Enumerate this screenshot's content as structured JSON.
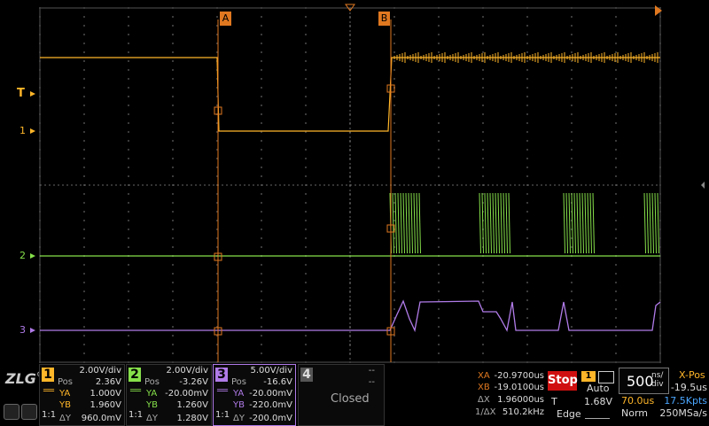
{
  "cursors": {
    "a_label": "A",
    "b_label": "B"
  },
  "left_markers": {
    "trigger": "T",
    "ch1": "1",
    "ch2": "2",
    "ch3": "3"
  },
  "channels": [
    {
      "num": "1",
      "color": "#ffb629",
      "scale": "2.00V/div",
      "pos_label": "Pos",
      "pos": "2.36V",
      "ya_label": "YA",
      "ya": "1.000V",
      "yb_label": "YB",
      "yb": "1.960V",
      "dy_label": "ΔY",
      "dy": "960.0mV",
      "coupling": "1:1"
    },
    {
      "num": "2",
      "color": "#86e04a",
      "scale": "2.00V/div",
      "pos_label": "Pos",
      "pos": "-3.26V",
      "ya_label": "YA",
      "ya": "-20.00mV",
      "yb_label": "YB",
      "yb": "1.260V",
      "dy_label": "ΔY",
      "dy": "1.280V",
      "coupling": "1:1"
    },
    {
      "num": "3",
      "color": "#b07be8",
      "scale": "5.00V/div",
      "pos_label": "Pos",
      "pos": "-16.6V",
      "ya_label": "YA",
      "ya": "-20.00mV",
      "yb_label": "YB",
      "yb": "-220.0mV",
      "dy_label": "ΔY",
      "dy": "-200.0mV",
      "coupling": "1:1"
    },
    {
      "num": "4",
      "color": "#555555",
      "scale": "--",
      "pos_label": "",
      "pos": "--",
      "status": "Closed"
    }
  ],
  "measurements": {
    "xa_label": "XA",
    "xa": "-20.9700us",
    "xb_label": "XB",
    "xb": "-19.0100us",
    "dx_label": "ΔX",
    "dx": "1.96000us",
    "inv_label": "1/ΔX",
    "inv": "510.2kHz"
  },
  "run_state": "Stop",
  "trigger": {
    "source": "1",
    "mode": "Auto",
    "level_label": "T",
    "level": "1.68V",
    "type": "Edge"
  },
  "timebase": {
    "value": "500",
    "unit_top": "ns/",
    "unit_bottom": "div",
    "xpos_label": "X-Pos",
    "xpos": "-19.5us",
    "delay": "70.0us",
    "points": "17.5Kpts",
    "acq_mode": "Norm",
    "rate": "250MSa/s"
  },
  "logo": "ZLG"
}
